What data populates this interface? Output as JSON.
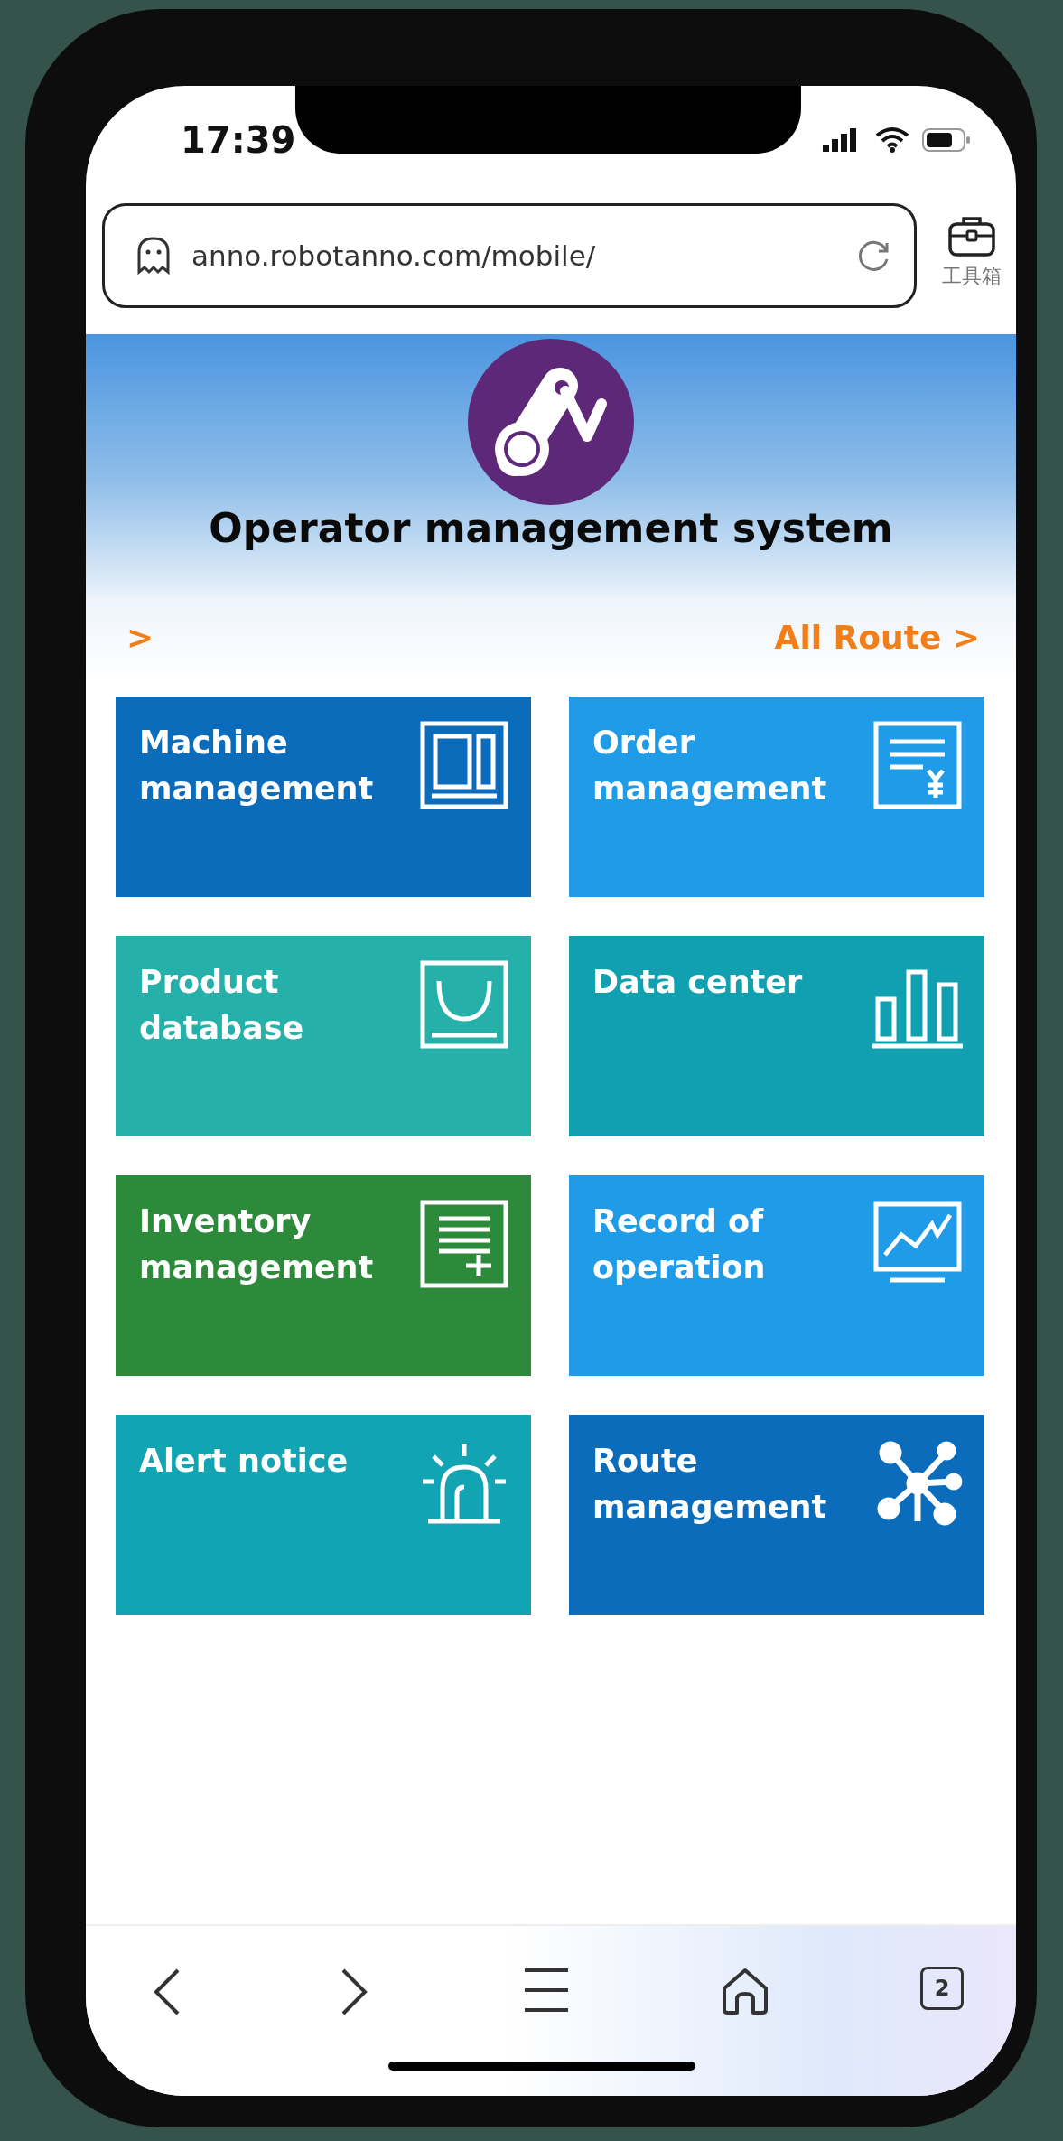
{
  "status_bar": {
    "time": "17:39"
  },
  "browser": {
    "url": "anno.robotanno.com/mobile/",
    "toolbox_label": "工具箱"
  },
  "header": {
    "title": "Operator management system"
  },
  "links": {
    "left": ">",
    "right": "All Route >"
  },
  "tiles": [
    {
      "label": "Machine management",
      "color": "#0b6cbc",
      "kind": "panel"
    },
    {
      "label": "Order management",
      "color": "#1f9be8",
      "kind": "invoice"
    },
    {
      "label": "Product database",
      "color": "#25b1a9",
      "kind": "bag"
    },
    {
      "label": "Data center",
      "color": "#10a0b0",
      "kind": "bars"
    },
    {
      "label": "Inventory management",
      "color": "#2d8a3a",
      "kind": "list"
    },
    {
      "label": "Record of operation",
      "color": "#1f9be8",
      "kind": "monitor"
    },
    {
      "label": "Alert notice",
      "color": "#13a4b3",
      "kind": "alarm"
    },
    {
      "label": "Route management",
      "color": "#0b6cbc",
      "kind": "network"
    }
  ],
  "bottom_nav": {
    "tab_count": "2"
  }
}
